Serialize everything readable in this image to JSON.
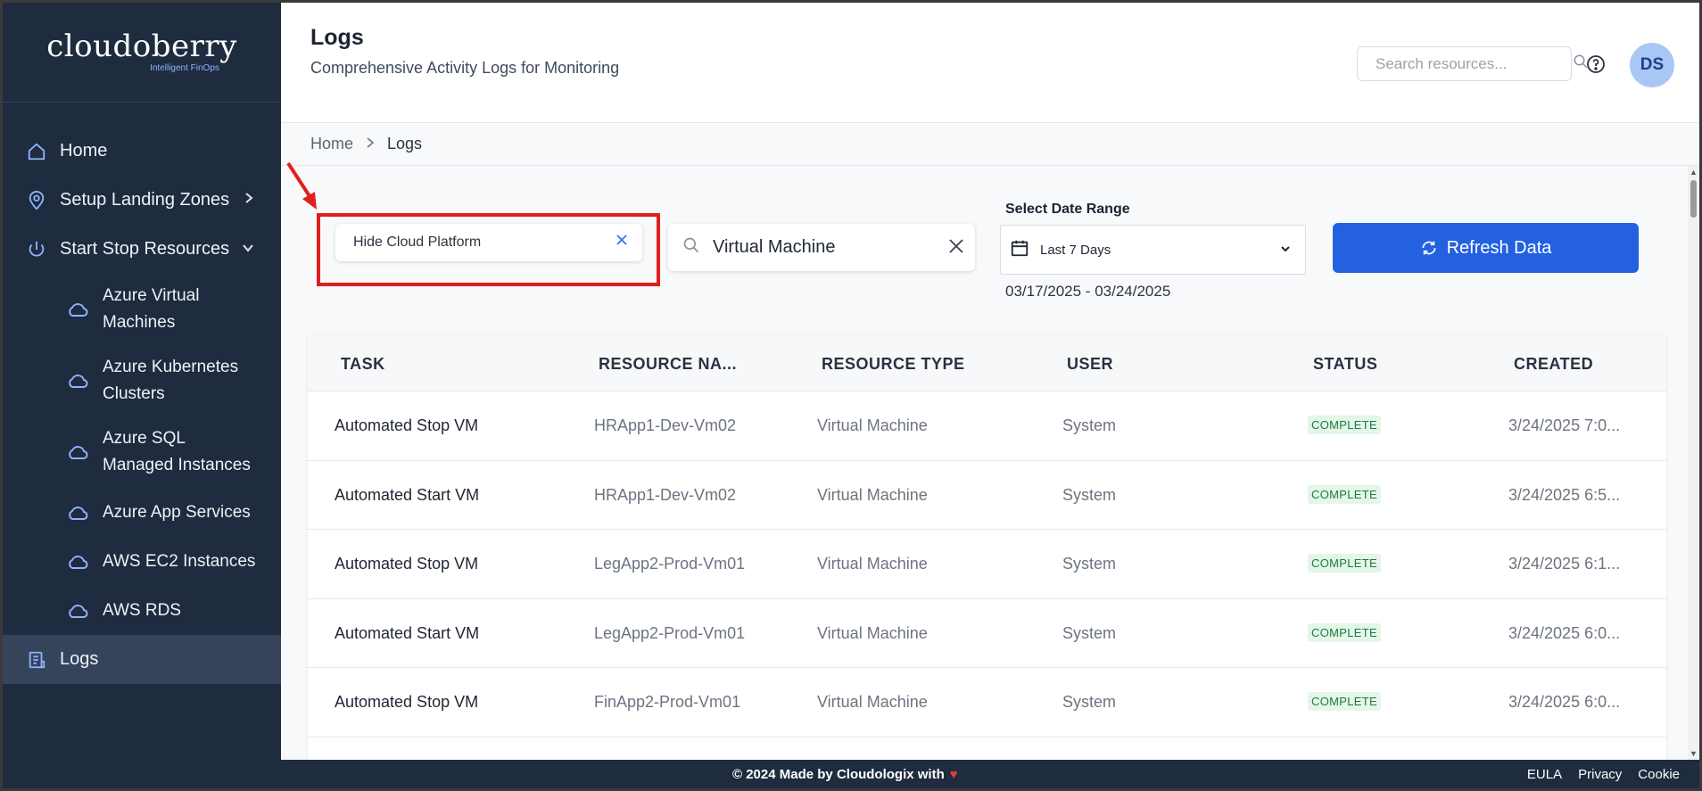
{
  "brand": {
    "name": "cloudoberry",
    "tagline": "Intelligent FinOps"
  },
  "sidebar": {
    "items": [
      {
        "label": "Home",
        "icon": "home-icon"
      },
      {
        "label": "Setup Landing Zones",
        "icon": "location-pin-icon"
      },
      {
        "label": "Start Stop Resources",
        "icon": "power-icon"
      },
      {
        "label": "Logs",
        "icon": "document-list-icon"
      }
    ],
    "sub_items": [
      {
        "label": "Azure Virtual Machines",
        "icon": "cloud-icon"
      },
      {
        "label": "Azure Kubernetes Clusters",
        "icon": "cloud-icon"
      },
      {
        "label": "Azure SQL Managed Instances",
        "icon": "cloud-icon"
      },
      {
        "label": "Azure App Services",
        "icon": "cloud-icon"
      },
      {
        "label": "AWS EC2 Instances",
        "icon": "cloud-icon"
      },
      {
        "label": "AWS RDS",
        "icon": "cloud-icon"
      }
    ],
    "active": "Logs"
  },
  "header": {
    "title": "Logs",
    "subtitle": "Comprehensive Activity Logs for Monitoring",
    "search_placeholder": "Search resources...",
    "avatar_initials": "DS"
  },
  "breadcrumb": {
    "home": "Home",
    "current": "Logs"
  },
  "filters": {
    "platform_chip": "Hide Cloud Platform",
    "resource_search_value": "Virtual Machine",
    "date_range_label": "Select Date Range",
    "date_range_selected": "Last 7 Days",
    "date_range_text": "03/17/2025 - 03/24/2025",
    "refresh_label": "Refresh Data"
  },
  "table": {
    "columns": [
      "TASK",
      "RESOURCE NA...",
      "RESOURCE TYPE",
      "USER",
      "STATUS",
      "CREATED"
    ],
    "rows": [
      {
        "task": "Automated Stop VM",
        "resource": "HRApp1-Dev-Vm02",
        "type": "Virtual Machine",
        "user": "System",
        "status": "COMPLETE",
        "created": "3/24/2025 7:0..."
      },
      {
        "task": "Automated Start VM",
        "resource": "HRApp1-Dev-Vm02",
        "type": "Virtual Machine",
        "user": "System",
        "status": "COMPLETE",
        "created": "3/24/2025 6:5..."
      },
      {
        "task": "Automated Stop VM",
        "resource": "LegApp2-Prod-Vm01",
        "type": "Virtual Machine",
        "user": "System",
        "status": "COMPLETE",
        "created": "3/24/2025 6:1..."
      },
      {
        "task": "Automated Start VM",
        "resource": "LegApp2-Prod-Vm01",
        "type": "Virtual Machine",
        "user": "System",
        "status": "COMPLETE",
        "created": "3/24/2025 6:0..."
      },
      {
        "task": "Automated Stop VM",
        "resource": "FinApp2-Prod-Vm01",
        "type": "Virtual Machine",
        "user": "System",
        "status": "COMPLETE",
        "created": "3/24/2025 6:0..."
      }
    ]
  },
  "footer": {
    "copyright": "© 2024 Made by Cloudologix with",
    "heart": "♥",
    "links": [
      "EULA",
      "Privacy",
      "Cookie"
    ]
  },
  "colors": {
    "sidebar_bg": "#1f2b3e",
    "accent": "#2361e0",
    "annotation": "#e0201e",
    "status_complete_bg": "#e3f6e8",
    "status_complete_text": "#1e7a3e"
  }
}
